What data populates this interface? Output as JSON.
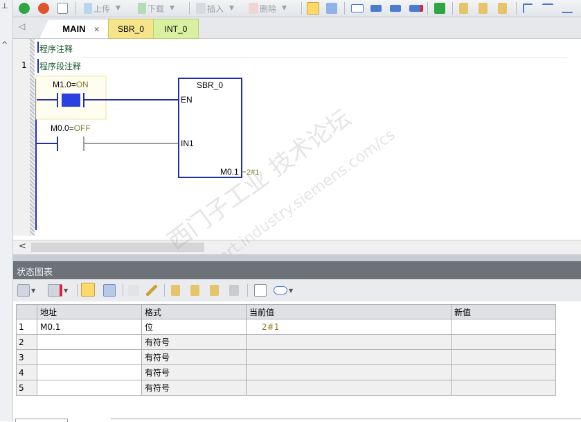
{
  "toolbar": {
    "upload_label": "上传",
    "download_label": "下载",
    "insert_label": "插入",
    "delete_label": "删除"
  },
  "tabs": [
    {
      "label": "MAIN",
      "close": "×"
    },
    {
      "label": "SBR_0"
    },
    {
      "label": "INT_0"
    }
  ],
  "editor": {
    "program_comment": "程序注释",
    "network_number": "1",
    "network_comment": "程序段注释",
    "contact1": {
      "address": "M1.0",
      "equals": "=",
      "state": "ON"
    },
    "contact2": {
      "address": "M0.0",
      "equals": "=",
      "state": "OFF"
    },
    "block": {
      "name": "SBR_0",
      "en": "EN",
      "in1": "IN1",
      "out": "M0.1",
      "out_value": "2#1"
    }
  },
  "status_chart": {
    "title": "状态图表",
    "columns": [
      "地址",
      "格式",
      "当前值",
      "新值"
    ],
    "rows": [
      {
        "num": "1",
        "address": "M0.1",
        "format": "位",
        "current": "2#1",
        "new": ""
      },
      {
        "num": "2",
        "address": "",
        "format": "有符号",
        "current": "",
        "new": ""
      },
      {
        "num": "3",
        "address": "",
        "format": "有符号",
        "current": "",
        "new": ""
      },
      {
        "num": "4",
        "address": "",
        "format": "有符号",
        "current": "",
        "new": ""
      },
      {
        "num": "5",
        "address": "",
        "format": "有符号",
        "current": "",
        "new": ""
      }
    ]
  },
  "watermark": {
    "line1": "西门子工业 技术论坛",
    "line2": "support.industry.siemens.com/cs"
  },
  "colors": {
    "ladder_blue": "#1f2fa6",
    "contact_on_fill": "#2a40e0",
    "value_olive": "#8a7a2a",
    "tab_sbr": "#f6e48a",
    "tab_int": "#d9f0a0"
  },
  "icons": {
    "run": "green-play-icon",
    "stop": "red-stop-icon",
    "compile": "check-doc-icon"
  }
}
